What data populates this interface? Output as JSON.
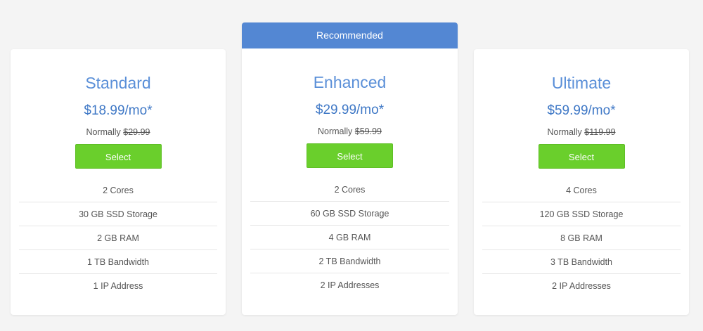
{
  "plans": [
    {
      "name": "Standard",
      "price": "$18.99/mo*",
      "normally_label": "Normally",
      "old_price": "$29.99",
      "button_label": "Select",
      "features": [
        "2 Cores",
        "30 GB SSD Storage",
        "2 GB RAM",
        "1 TB Bandwidth",
        "1 IP Address"
      ]
    },
    {
      "banner": "Recommended",
      "name": "Enhanced",
      "price": "$29.99/mo*",
      "normally_label": "Normally",
      "old_price": "$59.99",
      "button_label": "Select",
      "features": [
        "2 Cores",
        "60 GB SSD Storage",
        "4 GB RAM",
        "2 TB Bandwidth",
        "2 IP Addresses"
      ]
    },
    {
      "name": "Ultimate",
      "price": "$59.99/mo*",
      "normally_label": "Normally",
      "old_price": "$119.99",
      "button_label": "Select",
      "features": [
        "4 Cores",
        "120 GB SSD Storage",
        "8 GB RAM",
        "3 TB Bandwidth",
        "2 IP Addresses"
      ]
    }
  ],
  "colors": {
    "background": "#f4f4f4",
    "banner": "#5387d3",
    "plan_name": "#5a8fd8",
    "price": "#3f78c6",
    "button": "#6acf2c"
  }
}
